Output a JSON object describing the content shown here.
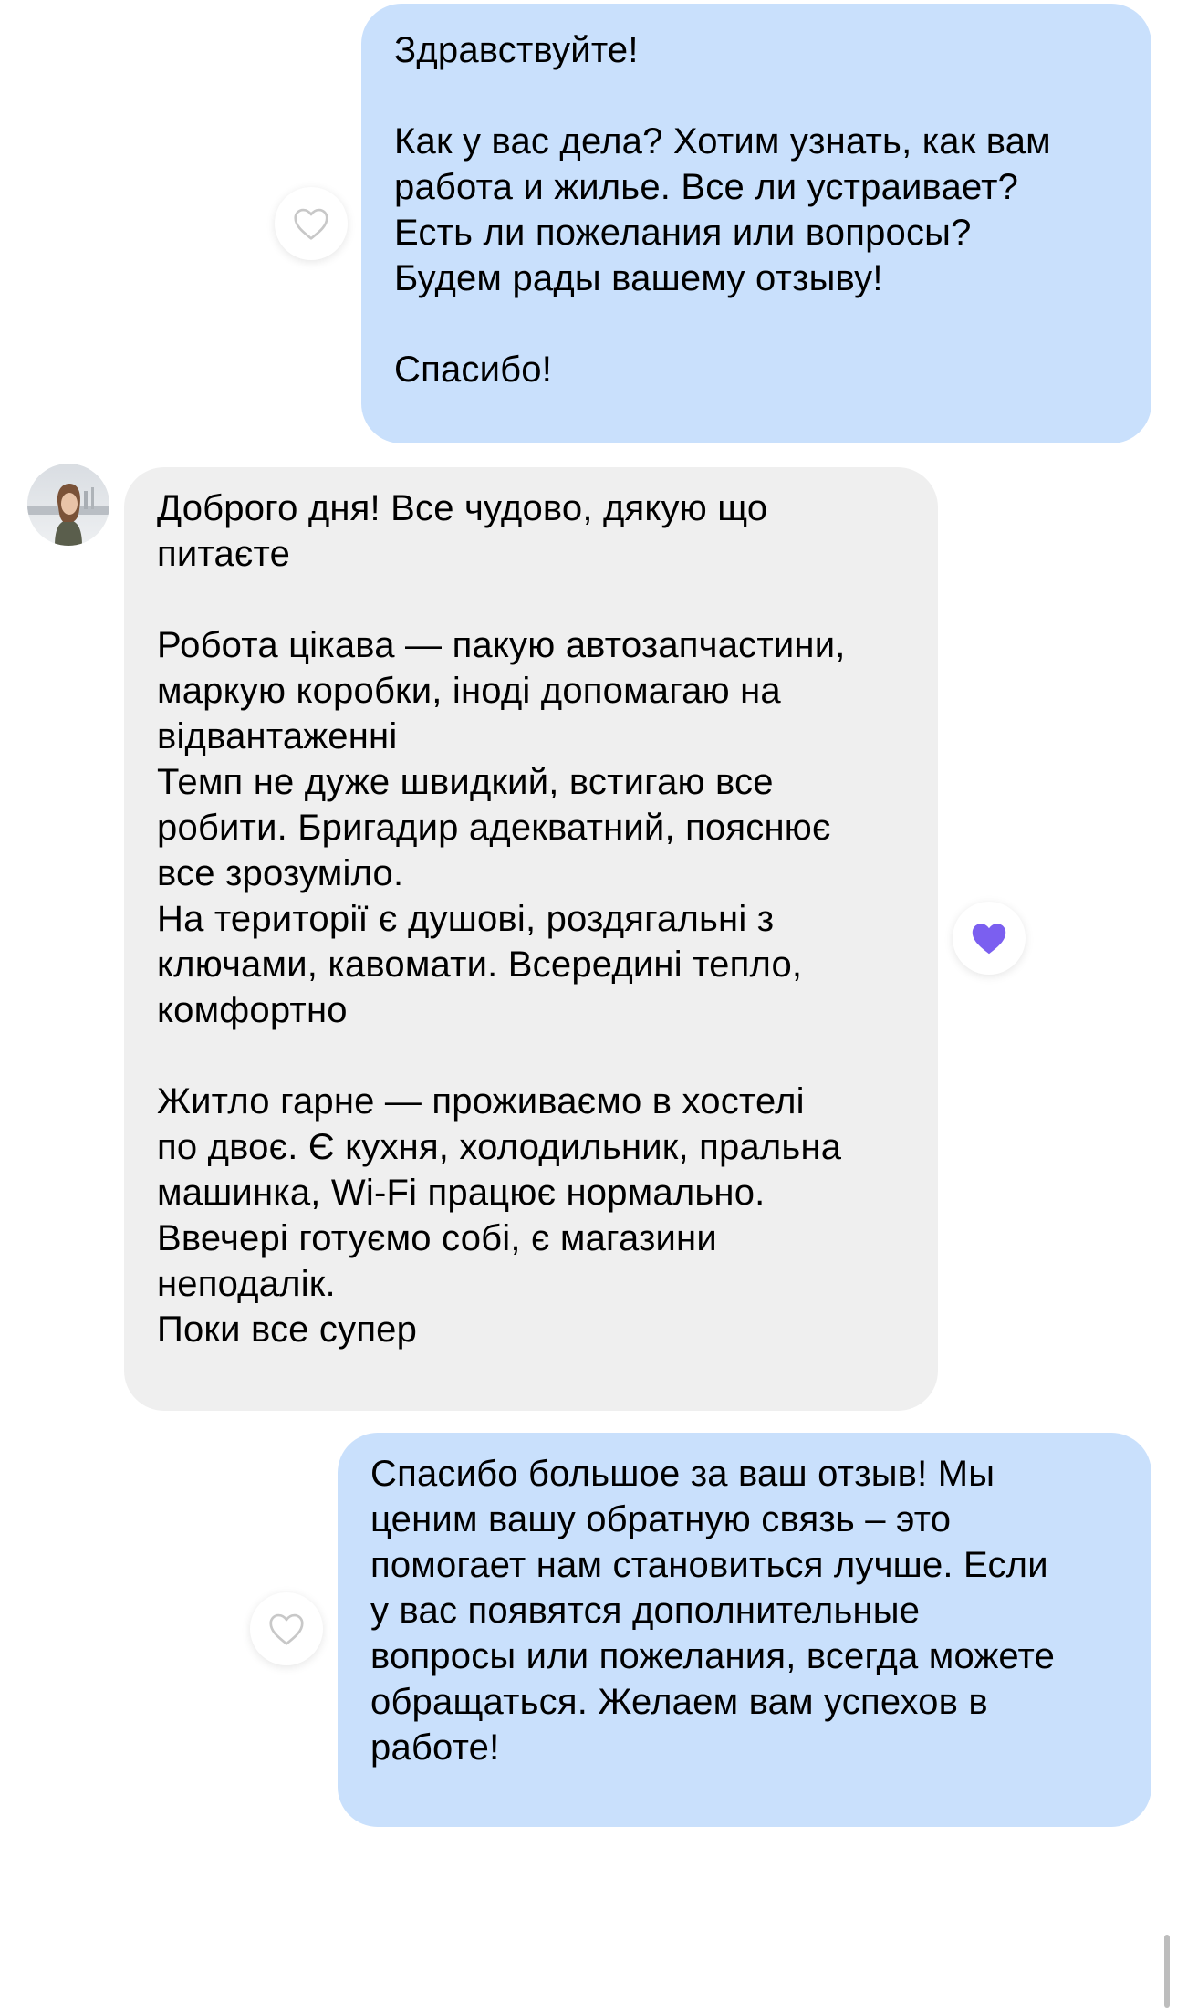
{
  "messages": [
    {
      "id": "msg1",
      "direction": "outgoing",
      "paragraphs": [
        "Здравствуйте!",
        "Как у вас дела? Хотим узнать, как вам\nработа и жилье. Все ли устраивает?\nЕсть ли пожелания или вопросы?\nБудем рады вашему отзыву!",
        "Спасибо!"
      ],
      "reaction": {
        "icon": "heart-outline-icon",
        "liked": false
      }
    },
    {
      "id": "msg2",
      "direction": "incoming",
      "sender_avatar": "avatar",
      "paragraphs": [
        "Доброго дня! Все чудово, дякую що\nпитаєте",
        "Робота цікава — пакую автозапчастини,\nмаркую коробки, іноді допомагаю на\nвідвантаженні\nТемп не дуже швидкий, встигаю все\nробити. Бригадир адекватний, пояснює\nвсе зрозуміло.\nНа території є душові, роздягальні з\nключами, кавомати. Всередині тепло,\nкомфортно",
        "Житло гарне — проживаємо в хостелі\nпо двоє. Є кухня, холодильник, пральна\nмашинка, Wi-Fi працює нормально.\nВвечері готуємо собі, є магазини\nнеподалік.\nПоки все супер"
      ],
      "reaction": {
        "icon": "heart-filled-icon",
        "liked": true
      }
    },
    {
      "id": "msg3",
      "direction": "outgoing",
      "paragraphs": [
        "Спасибо большое за ваш отзыв! Мы\nценим вашу обратную связь – это\nпомогает нам становиться лучше. Если\nу вас появятся дополнительные\nвопросы или пожелания, всегда можете\nобращаться. Желаем вам успехов в\nработе!"
      ],
      "reaction": {
        "icon": "heart-outline-icon",
        "liked": false
      }
    }
  ],
  "colors": {
    "outgoing_bubble": "#c9e0fc",
    "incoming_bubble": "#efefef",
    "heart_liked": "#7b5ff0",
    "heart_outline": "#c8c8c8",
    "background": "#ffffff"
  }
}
